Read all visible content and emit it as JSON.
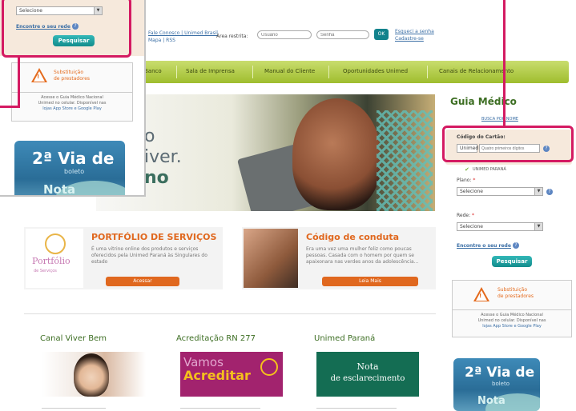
{
  "header": {
    "links_line1": "Fale Conosco | Unimed Brasil",
    "links_line2": "Mapa | RSS",
    "restricted_label": "Área restrita:",
    "user_placeholder": "Usuário",
    "password_placeholder": "Senha",
    "go_label": "OK",
    "forgot_line1": "Esqueci a senha",
    "forgot_line2": "Cadastre-se"
  },
  "nav": {
    "items": [
      "Banco",
      "Sala de Imprensa",
      "Manual do Cliente",
      "Oportunidades Unimed",
      "Canais de Relacionamento"
    ]
  },
  "hero": {
    "line1": "o",
    "line2": "iver.",
    "line3": "no"
  },
  "portfolio": {
    "logo_text": "Portfólio",
    "logo_sub": "de Serviços",
    "title": "PORTFÓLIO DE SERVIÇOS",
    "text": "É uma vitrine online dos produtos e serviços oferecidos pela Unimed Paraná às Singulares do estado",
    "button": "Acessar"
  },
  "conduta": {
    "title": "Código de conduta",
    "text": "Era uma vez uma mulher feliz como poucas pessoas. Casada com o homem por quem se apaixonara nas verdes anos da adolescência...",
    "button": "Leia Mais"
  },
  "bottom": {
    "col1_title": "Canal Viver Bem",
    "col2_title": "Acreditação RN 277",
    "col2_banner_line1": "Vamos",
    "col2_banner_line2": "Acreditar",
    "col3_title": "Unimed Paraná",
    "col3_banner_line1": "Nota",
    "col3_banner_line2": "de esclarecimento"
  },
  "guia": {
    "title": "Guia Médico",
    "link": "BUSCA POR NOME",
    "card_code_label": "Código do Cartão:",
    "card_prefix": "Unimed",
    "card_digits_placeholder": "Quatro primeiros dígitos",
    "national_label": "UNIMED PARANÁ",
    "plan_label": "Plano:",
    "plan_value": "Selecione",
    "city_label": "Rede:",
    "city_value": "Selecione",
    "find_link": "Encontre o seu rede",
    "search_button": "Pesquisar",
    "warn_line1": "Substituição",
    "warn_line2": "de prestadores",
    "app_text_line1": "Acesse o Guia Médico Nacional",
    "app_text_line2": "Unimed no celular. Disponível nas",
    "app_text_line3": "lojas App Store e Google Play"
  },
  "boleto": {
    "line1": "2ª Via de",
    "line2": "boleto",
    "line3": "Nota"
  },
  "colors": {
    "highlight": "#d41a62",
    "nav_green": "#9fbd2e",
    "teal": "#128c8c",
    "orange": "#e0681f"
  }
}
